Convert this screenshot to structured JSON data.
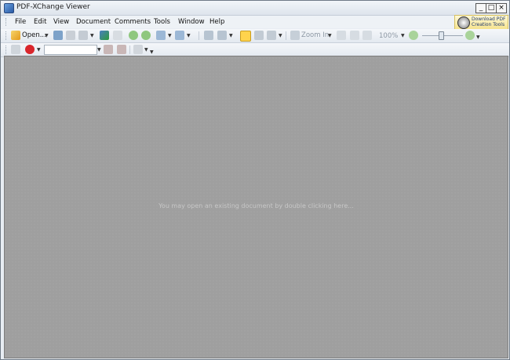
{
  "window": {
    "title": "PDF-XChange Viewer"
  },
  "titlebar_buttons": {
    "minimize": "_",
    "maximize": "□",
    "close": "×"
  },
  "menu": [
    "File",
    "Edit",
    "View",
    "Document",
    "Comments",
    "Tools",
    "Window",
    "Help"
  ],
  "promo": {
    "line1": "Download PDF",
    "line2": "Creation Tools"
  },
  "toolbar1": {
    "open_label": "Open...",
    "zoom_in_label": "Zoom In",
    "zoom_value": "100%"
  },
  "toolbar2": {
    "search_value": ""
  },
  "canvas": {
    "hint": "You may open an existing document by double clicking here..."
  },
  "colors": {
    "canvas_bg": "#9f9f9f",
    "titlebar": "#dde4ec",
    "promo_bg": "#f5e28a"
  },
  "icons": [
    "app-icon",
    "open-icon",
    "save-icon",
    "print-icon",
    "email-icon",
    "scan-icon",
    "ocr-icon",
    "back-icon",
    "forward-icon",
    "undo-icon",
    "redo-icon",
    "rotate-left-icon",
    "rotate-right-icon",
    "hand-tool-icon",
    "select-text-icon",
    "snapshot-icon",
    "zoom-in-icon",
    "actual-size-icon",
    "fit-page-icon",
    "fit-width-icon",
    "zoom-out-icon",
    "zoom-plus-icon",
    "glasses-icon",
    "acrobat-icon",
    "find-icon",
    "find-prev-icon",
    "typewriter-icon"
  ]
}
